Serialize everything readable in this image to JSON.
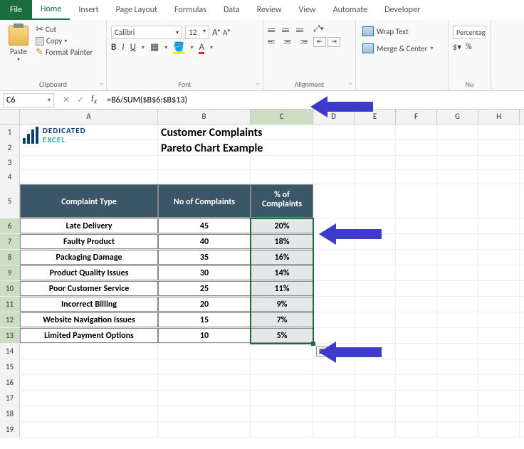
{
  "tabs": {
    "file": "File",
    "home": "Home",
    "insert": "Insert",
    "pagelayout": "Page Layout",
    "formulas": "Formulas",
    "data": "Data",
    "review": "Review",
    "view": "View",
    "automate": "Automate",
    "developer": "Developer"
  },
  "clipboard": {
    "cut": "Cut",
    "copy": "Copy",
    "fp": "Format Painter",
    "paste": "Paste",
    "label": "Clipboard"
  },
  "font": {
    "name": "Calibri",
    "size": "12",
    "label": "Font"
  },
  "alignment": {
    "wrap": "Wrap Text",
    "merge": "Merge & Center",
    "label": "Alignment"
  },
  "number": {
    "format": "Percentag",
    "label": "Nu"
  },
  "namebox": "C6",
  "formula": "=B6/SUM($B$6:$B$13)",
  "cols": [
    "A",
    "B",
    "C",
    "D",
    "E",
    "F",
    "G",
    "H"
  ],
  "logo": {
    "line1": "DEDICATED",
    "line2": "EXCEL"
  },
  "title": {
    "l1": "Customer Complaints",
    "l2": "Pareto Chart Example"
  },
  "headers": {
    "a": "Complaint Type",
    "b": "No of Complaints",
    "c": "% of Complaints"
  },
  "chart_data": {
    "type": "table",
    "title": "Customer Complaints Pareto Chart Example",
    "columns": [
      "Complaint Type",
      "No of Complaints",
      "% of Complaints"
    ],
    "rows": [
      {
        "type": "Late Delivery",
        "count": 45,
        "pct": "20%"
      },
      {
        "type": "Faulty Product",
        "count": 40,
        "pct": "18%"
      },
      {
        "type": "Packaging Damage",
        "count": 35,
        "pct": "16%"
      },
      {
        "type": "Product Quality Issues",
        "count": 30,
        "pct": "14%"
      },
      {
        "type": "Poor Customer Service",
        "count": 25,
        "pct": "11%"
      },
      {
        "type": "Incorrect Billing",
        "count": 20,
        "pct": "9%"
      },
      {
        "type": "Website Navigation Issues",
        "count": 15,
        "pct": "7%"
      },
      {
        "type": "Limited Payment Options",
        "count": 10,
        "pct": "5%"
      }
    ]
  },
  "rows_blank_start": 14,
  "rows_blank_end": 19
}
